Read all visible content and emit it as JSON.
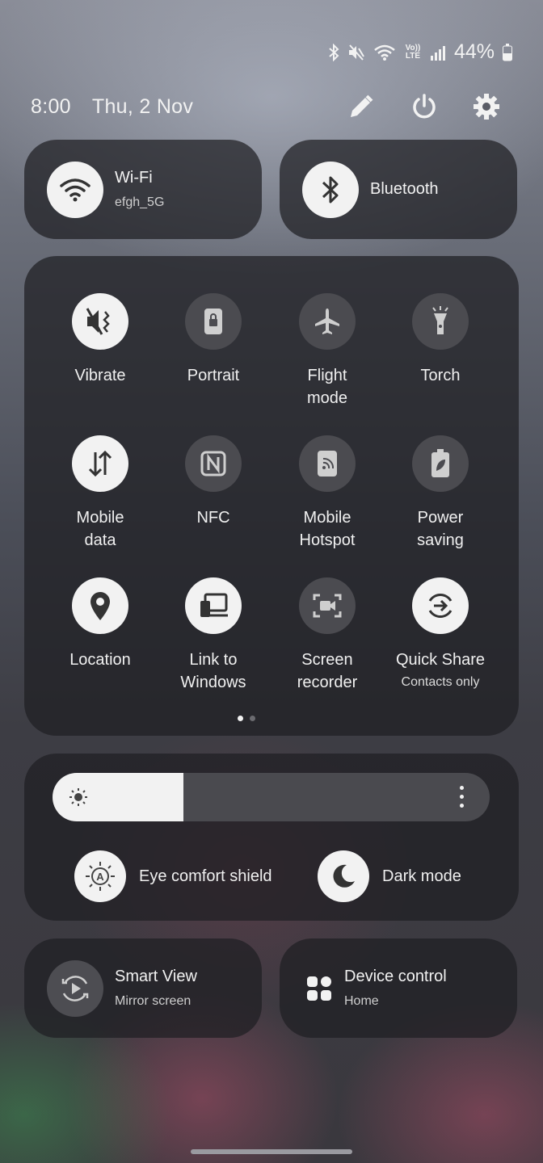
{
  "status_bar": {
    "battery": "44%",
    "volte": "Vo)) LTE"
  },
  "header": {
    "time": "8:00",
    "date": "Thu, 2 Nov"
  },
  "top_tiles": {
    "wifi": {
      "title": "Wi-Fi",
      "subtitle": "efgh_5G",
      "icon": "wifi-icon",
      "state": "on"
    },
    "bluetooth": {
      "title": "Bluetooth",
      "icon": "bluetooth-icon",
      "state": "on"
    }
  },
  "quick_settings": [
    {
      "label": "Vibrate",
      "icon": "vibrate-icon",
      "state": "on"
    },
    {
      "label": "Portrait",
      "icon": "portrait-lock-icon",
      "state": "off"
    },
    {
      "label": "Flight\nmode",
      "icon": "airplane-icon",
      "state": "off"
    },
    {
      "label": "Torch",
      "icon": "torch-icon",
      "state": "off"
    },
    {
      "label": "Mobile\ndata",
      "icon": "mobile-data-icon",
      "state": "on"
    },
    {
      "label": "NFC",
      "icon": "nfc-icon",
      "state": "off"
    },
    {
      "label": "Mobile\nHotspot",
      "icon": "hotspot-icon",
      "state": "off"
    },
    {
      "label": "Power\nsaving",
      "icon": "power-saving-icon",
      "state": "off"
    },
    {
      "label": "Location",
      "icon": "location-icon",
      "state": "on"
    },
    {
      "label": "Link to\nWindows",
      "icon": "link-to-windows-icon",
      "state": "on"
    },
    {
      "label": "Screen\nrecorder",
      "icon": "screen-recorder-icon",
      "state": "off"
    },
    {
      "label": "Quick Share",
      "sublabel": "Contacts only",
      "icon": "quick-share-icon",
      "state": "on"
    }
  ],
  "pagination": {
    "current": 1,
    "total": 2
  },
  "brightness": {
    "level": 0.3,
    "eye_comfort_label": "Eye comfort shield",
    "eye_comfort_badge": "A",
    "dark_mode_label": "Dark mode"
  },
  "bottom_tiles": {
    "smart_view": {
      "title": "Smart View",
      "subtitle": "Mirror screen",
      "icon": "smart-view-icon"
    },
    "device_control": {
      "title": "Device control",
      "subtitle": "Home",
      "icon": "device-control-icon"
    }
  }
}
